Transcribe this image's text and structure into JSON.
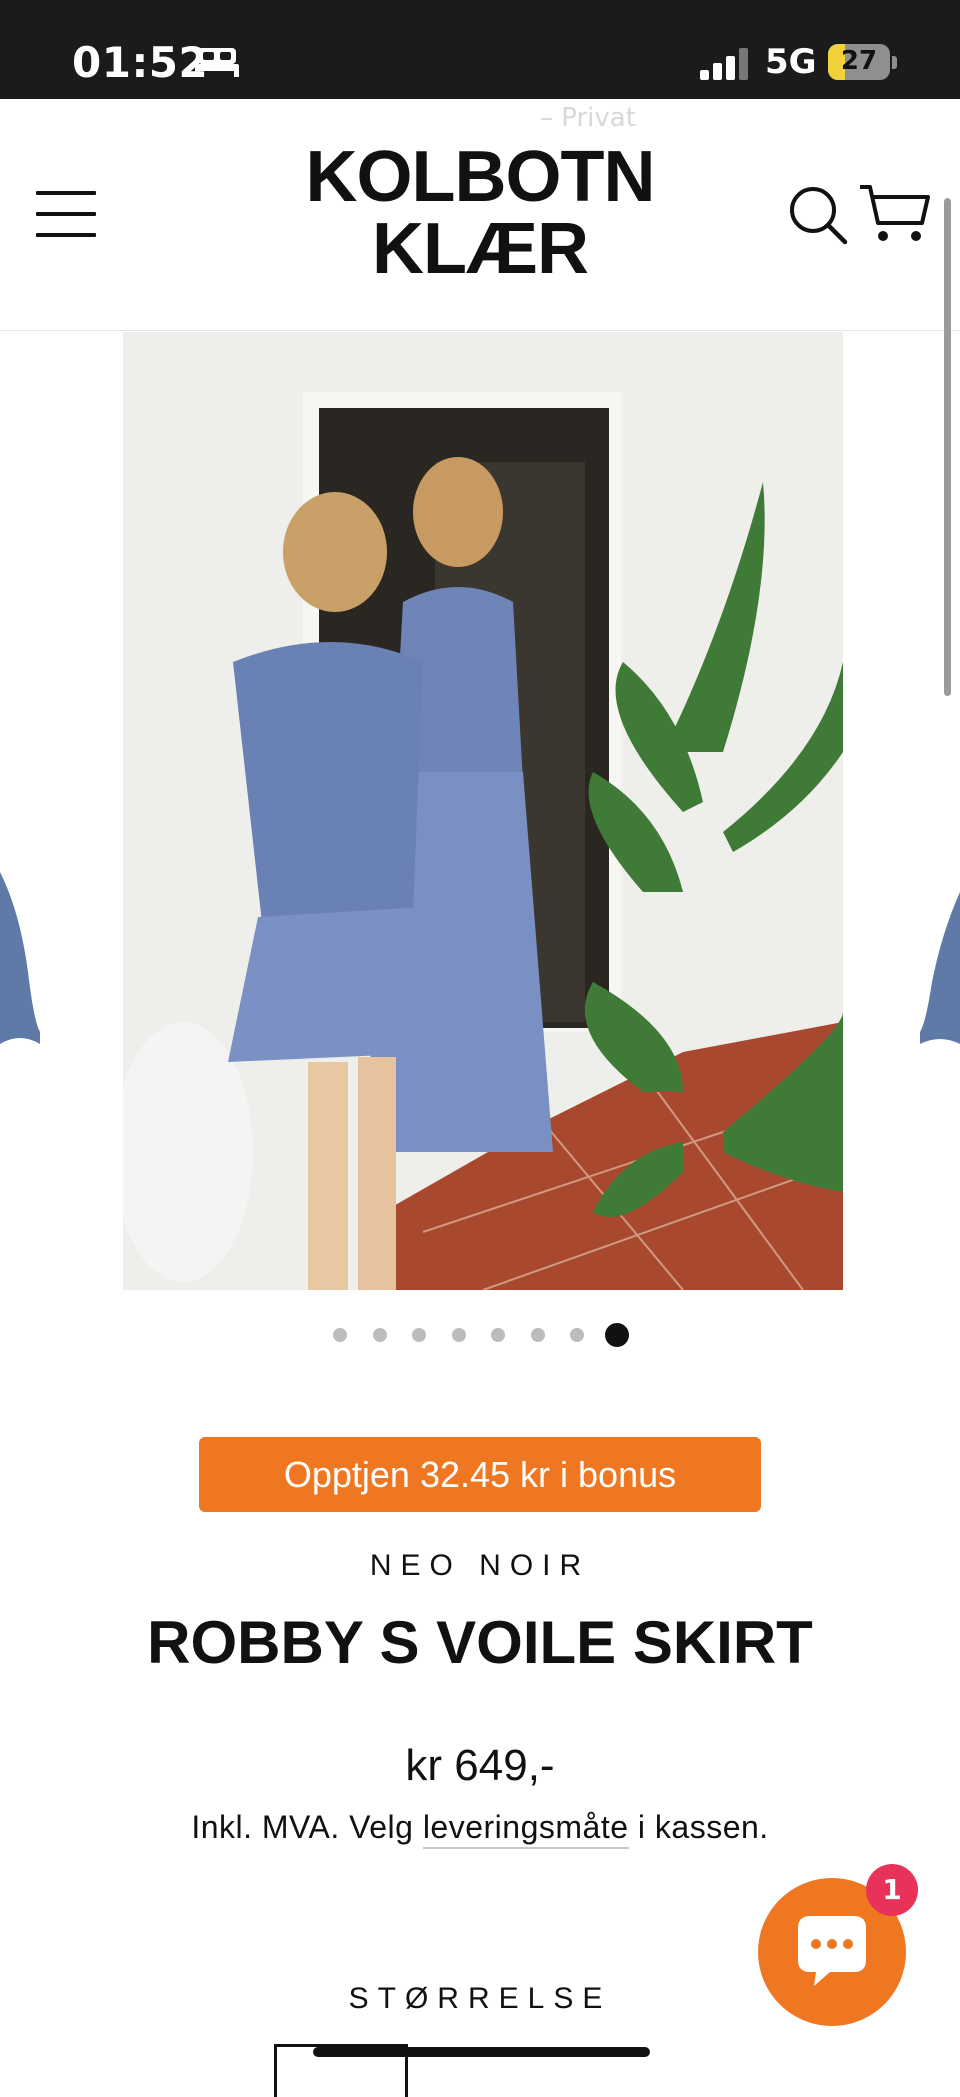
{
  "status_bar": {
    "time": "01:52",
    "network": "5G",
    "battery": "27",
    "battery_level": 0.27,
    "icons": [
      "sleep-bed-icon",
      "signal-icon",
      "battery-icon"
    ]
  },
  "header": {
    "ghost_text": "– Privat",
    "logo_line1": "KOLBOTN",
    "logo_line2": "KLÆR",
    "icons": [
      "hamburger-menu-icon",
      "search-icon",
      "cart-icon"
    ]
  },
  "gallery": {
    "total_images": 8,
    "active_index": 7,
    "zoom_icon": "magnifier-icon"
  },
  "product": {
    "bonus_label": "Opptjen 32.45 kr i bonus",
    "vendor": "NEO NOIR",
    "title": "ROBBY S VOILE SKIRT",
    "price": "kr 649,-",
    "tax_prefix": "Inkl. MVA. Velg ",
    "tax_link": "leveringsmåte",
    "tax_suffix": " i kassen.",
    "size_label": "STØRRELSE"
  },
  "chat": {
    "badge_count": "1",
    "icon": "chat-bubble-icon"
  },
  "colors": {
    "accent": "#f07722",
    "badge": "#e8325a",
    "status_bar_bg": "#1b1b1b",
    "text": "#111111"
  }
}
